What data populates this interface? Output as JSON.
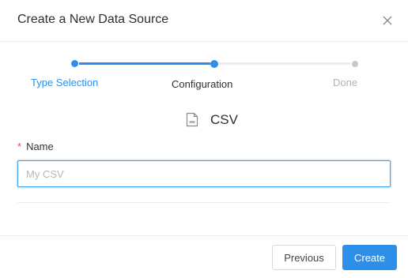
{
  "dialog": {
    "title": "Create a New Data Source",
    "close_icon": "close-icon"
  },
  "steps": [
    {
      "label": "Type Selection",
      "state": "done"
    },
    {
      "label": "Configuration",
      "state": "active"
    },
    {
      "label": "Done",
      "state": "pending"
    }
  ],
  "colors": {
    "accent": "#2d8fea",
    "step_done_label": "#2d8fea",
    "step_pending": "#c8c8c8",
    "required": "#e5484d"
  },
  "type": {
    "icon": "file-icon",
    "name": "CSV"
  },
  "form": {
    "name_required_mark": "*",
    "name_label": "Name",
    "name_value": "",
    "name_placeholder": "My CSV"
  },
  "footer": {
    "previous_label": "Previous",
    "create_label": "Create"
  }
}
